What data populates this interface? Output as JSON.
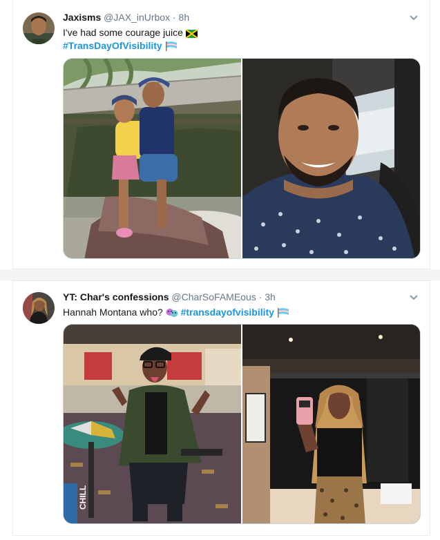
{
  "tweets": [
    {
      "name": "Jaxisms",
      "handle": "@JAX_inUrbox",
      "separator": "·",
      "time": "8h",
      "text": "I've had some courage juice",
      "hashtag": "#TransDayOfVisibility"
    },
    {
      "name": "YT: Char's confessions",
      "handle": "@CharSoFAMEous",
      "separator": "·",
      "time": "3h",
      "text": "Hannah Montana who?",
      "hashtag": "#transdayofvisibility",
      "photo_sign": "CHILL"
    }
  ],
  "icons": [
    "jamaica-flag-icon",
    "trans-flag-icon",
    "masks-emoji-icon",
    "chevron-down-icon"
  ],
  "colors": {
    "hashtag": "#1b95e0",
    "name": "#14171a",
    "meta": "#657786",
    "border": "#e6ecf0"
  }
}
